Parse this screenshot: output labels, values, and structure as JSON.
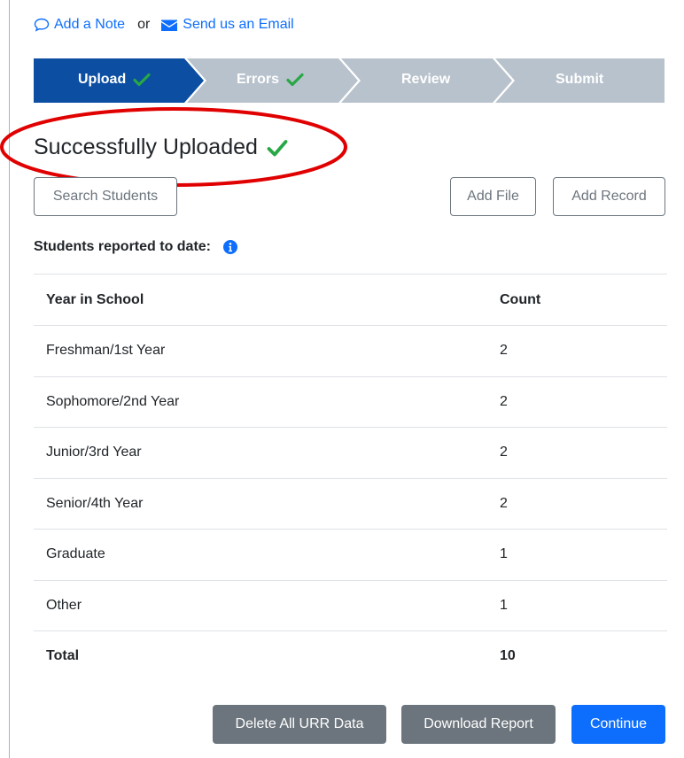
{
  "links": {
    "note": "Add a Note",
    "or": "or",
    "email": "Send us an Email"
  },
  "steps": [
    {
      "label": "Upload",
      "state": "active",
      "color": "#0b4ea2"
    },
    {
      "label": "Errors",
      "state": "complete",
      "color": "#b8c2cc"
    },
    {
      "label": "Review",
      "state": "pending",
      "color": "#b8c2cc"
    },
    {
      "label": "Submit",
      "state": "pending",
      "color": "#b8c2cc"
    }
  ],
  "title": "Successfully Uploaded",
  "buttons": {
    "search": "Search Students",
    "add_file": "Add File",
    "add_record": "Add Record",
    "delete_all": "Delete All URR Data",
    "download": "Download Report",
    "continue": "Continue"
  },
  "reported_label": "Students reported to date:",
  "table": {
    "headers": [
      "Year in School",
      "Count"
    ],
    "rows": [
      [
        "Freshman/1st Year",
        "2"
      ],
      [
        "Sophomore/2nd Year",
        "2"
      ],
      [
        "Junior/3rd Year",
        "2"
      ],
      [
        "Senior/4th Year",
        "2"
      ],
      [
        "Graduate",
        "1"
      ],
      [
        "Other",
        "1"
      ]
    ],
    "total": [
      "Total",
      "10"
    ]
  },
  "colors": {
    "accent": "#0d6efd",
    "check": "#28a745",
    "annotation": "#e00000",
    "step_active": "#0b4ea2",
    "step_inactive": "#b8c2cc"
  }
}
